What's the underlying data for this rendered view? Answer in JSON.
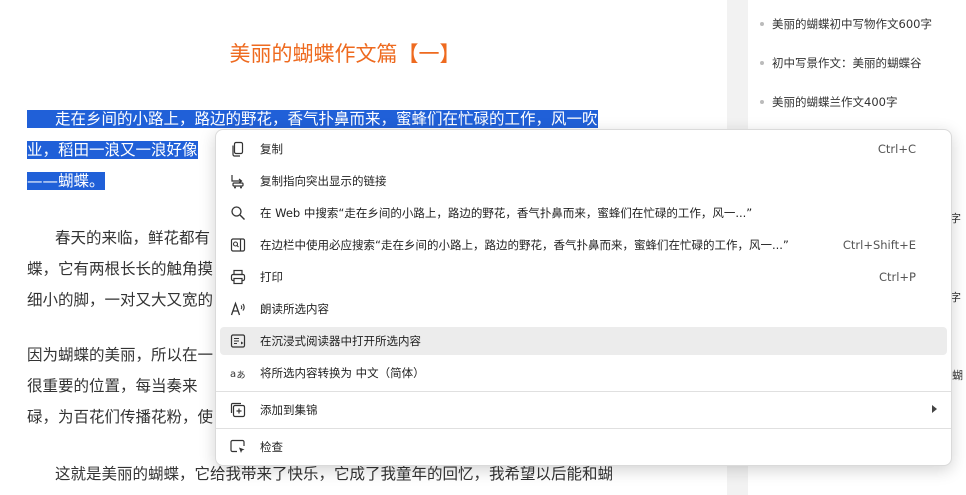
{
  "article": {
    "title": "美丽的蝴蝶作文篇【一】",
    "p1": [
      "走在乡间的小路上，路边的野花，香气扑鼻而来，蜜蜂们在忙碌的工作，风一吹",
      "业，稻田一浪又一浪好像",
      "——蝴蝶。"
    ],
    "p2": [
      "春天的来临，鲜花都有",
      "蝶，它有两根长长的触角摸",
      "细小的脚，一对又大又宽的"
    ],
    "p3": [
      "因为蝴蝶的美丽，所以在一",
      "很重要的位置，每当奏来",
      "碌，为百花们传播花粉，使"
    ],
    "p4": [
      "这就是美丽的蝴蝶，它给我带来了快乐，它成了我童年的回忆，我希望以后能和蝴"
    ]
  },
  "sidebar": {
    "links": [
      "美丽的蝴蝶初中写物作文600字",
      "初中写景作文：美丽的蝴蝶谷",
      "美丽的蝴蝶兰作文400字"
    ],
    "fragments": [
      "字",
      "字",
      "蝴"
    ]
  },
  "context_menu": {
    "items": [
      {
        "label": "复制",
        "shortcut": "Ctrl+C",
        "icon": "copy-icon"
      },
      {
        "label": "复制指向突出显示的链接",
        "shortcut": "",
        "icon": "link-highlight-icon"
      },
      {
        "label": "在 Web 中搜索“走在乡间的小路上，路边的野花，香气扑鼻而来，蜜蜂们在忙碌的工作，风一...”",
        "shortcut": "",
        "icon": "search-icon"
      },
      {
        "label": "在边栏中使用必应搜索“走在乡间的小路上，路边的野花，香气扑鼻而来，蜜蜂们在忙碌的工作，风一...”",
        "shortcut": "Ctrl+Shift+E",
        "icon": "sidebar-search-icon"
      },
      {
        "label": "打印",
        "shortcut": "Ctrl+P",
        "icon": "print-icon"
      },
      {
        "label": "朗读所选内容",
        "shortcut": "",
        "icon": "read-aloud-icon"
      },
      {
        "label": "在沉浸式阅读器中打开所选内容",
        "shortcut": "",
        "icon": "immersive-reader-icon"
      },
      {
        "label": "将所选内容转换为 中文（简体）",
        "shortcut": "",
        "icon": "translate-icon"
      },
      {
        "label": "添加到集锦",
        "shortcut": "",
        "icon": "collections-icon"
      },
      {
        "label": "检查",
        "shortcut": "",
        "icon": "inspect-icon"
      }
    ]
  },
  "colors": {
    "selection": "#2060d8",
    "title": "#ee6a1f",
    "menu_hover": "#ececec"
  }
}
